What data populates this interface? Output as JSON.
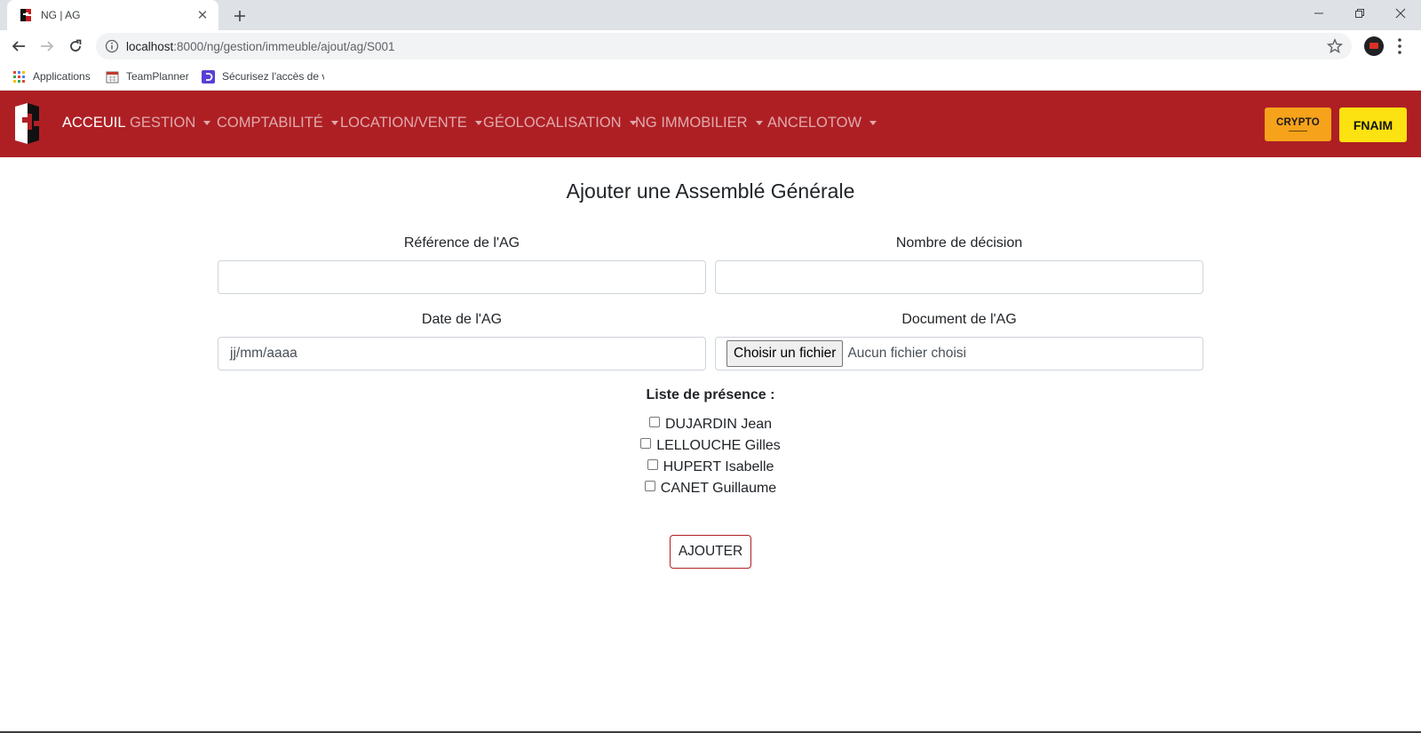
{
  "browser": {
    "tab_title": "NG | AG",
    "url_host": "localhost",
    "url_path": ":8000/ng/gestion/immeuble/ajout/ag/S001",
    "bookmarks": [
      {
        "label": "Applications",
        "icon": "apps-grid-icon"
      },
      {
        "label": "TeamPlanner",
        "icon": "calendar-icon"
      },
      {
        "label": "Sécurisez l'accès de v",
        "icon": "dashlane-icon"
      }
    ]
  },
  "navbar": {
    "brand_color": "#ae1f24",
    "items": [
      {
        "label": "ACCEUIL",
        "active": true,
        "dropdown": false
      },
      {
        "label": "GESTION",
        "active": false,
        "dropdown": true
      },
      {
        "label": "COMPTABILITÉ",
        "active": false,
        "dropdown": true
      },
      {
        "label": "LOCATION/VENTE",
        "active": false,
        "dropdown": true
      },
      {
        "label": "GÉOLOCALISATION",
        "active": false,
        "dropdown": true
      },
      {
        "label": "NG IMMOBILIER",
        "active": false,
        "dropdown": true
      },
      {
        "label": "ANCELOTOW",
        "active": false,
        "dropdown": true
      }
    ],
    "crypto_label": "CRYPTO",
    "fnaim_label": "FNAIM"
  },
  "form": {
    "title": "Ajouter une Assemblé Générale",
    "reference_label": "Référence de l'AG",
    "reference_value": "",
    "decisions_label": "Nombre de décision",
    "decisions_value": "",
    "date_label": "Date de l'AG",
    "date_placeholder": "jj/mm/aaaa",
    "document_label": "Document de l'AG",
    "file_button_label": "Choisir un fichier",
    "file_status": "Aucun fichier choisi",
    "presence_title": "Liste de présence :",
    "presence": [
      {
        "name": "DUJARDIN Jean",
        "checked": false
      },
      {
        "name": "LELLOUCHE Gilles",
        "checked": false
      },
      {
        "name": "HUPERT Isabelle",
        "checked": false
      },
      {
        "name": "CANET Guillaume",
        "checked": false
      }
    ],
    "submit_label": "AJOUTER"
  }
}
